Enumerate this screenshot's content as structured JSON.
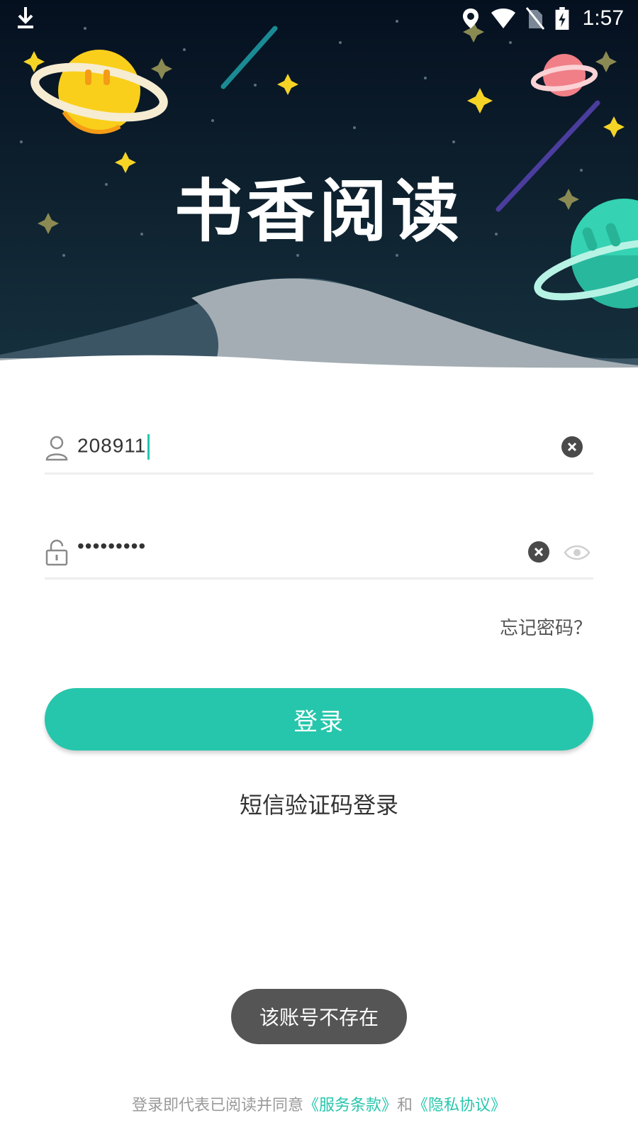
{
  "status_bar": {
    "time": "1:57",
    "icons": [
      "download-icon",
      "location-icon",
      "wifi-icon",
      "no-sim-icon",
      "battery-charging-icon"
    ]
  },
  "hero": {
    "app_title": "书香阅读"
  },
  "login_form": {
    "username": {
      "value": "208911",
      "icon": "user-icon",
      "clear_icon": "clear-icon"
    },
    "password": {
      "value": "•••••••••",
      "icon": "lock-icon",
      "clear_icon": "clear-icon",
      "visibility_icon": "eye-icon"
    },
    "forgot_password": "忘记密码？",
    "login_button": "登录",
    "sms_login": "短信验证码登录"
  },
  "toast": {
    "message": "该账号不存在"
  },
  "agreement": {
    "prefix": "登录即代表已阅读并同意",
    "terms_link": "《服务条款》",
    "conjunction": "和",
    "privacy_link": "《隐私协议》"
  },
  "colors": {
    "accent": "#26c6ac",
    "hero_bg": "#0e2130",
    "toast_bg": "#555555"
  }
}
